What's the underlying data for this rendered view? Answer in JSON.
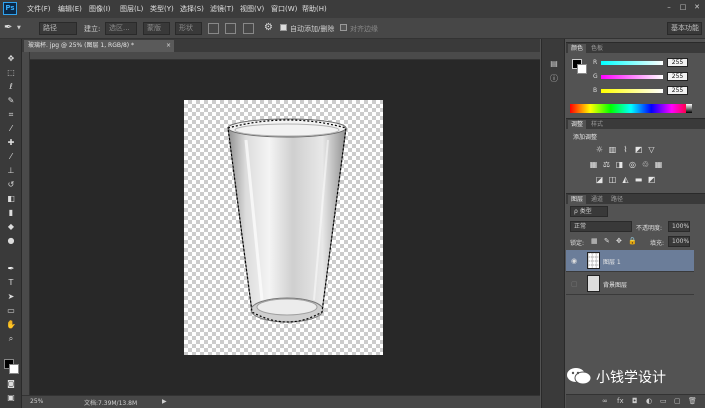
{
  "app": {
    "logo": "Ps"
  },
  "menu": [
    "文件(F)",
    "编辑(E)",
    "图像(I)",
    "图层(L)",
    "类型(Y)",
    "选择(S)",
    "滤镜(T)",
    "视图(V)",
    "窗口(W)",
    "帮助(H)"
  ],
  "window_controls": [
    "–",
    "□",
    "✕"
  ],
  "options": {
    "tool_preset": "路径",
    "build_label": "建立:",
    "select_btn": "选区...",
    "mask_btn": "蒙版",
    "shape_btn": "形状",
    "auto_add_delete": "自动添加/删除",
    "align_edges": "对齐边缘",
    "workspace": "基本功能"
  },
  "document": {
    "tab_title": "玻璃杯. jpg @ 25% (图层 1, RGB/8) *",
    "close": "×"
  },
  "status": {
    "zoom": "25%",
    "doc_size": "文档:7.39M/13.8M"
  },
  "color_panel": {
    "tabs": [
      "颜色",
      "色板"
    ],
    "channels": [
      {
        "letter": "R",
        "value": "255"
      },
      {
        "letter": "G",
        "value": "255"
      },
      {
        "letter": "B",
        "value": "255"
      }
    ]
  },
  "adjust_panel": {
    "tabs": [
      "调整",
      "样式"
    ],
    "title": "添加调整"
  },
  "layers_panel": {
    "tabs": [
      "图层",
      "通道",
      "路径"
    ],
    "filter": "ρ 类型",
    "blend_mode": "正常",
    "opacity_label": "不透明度:",
    "opacity": "100%",
    "lock_label": "锁定:",
    "fill_label": "填充:",
    "fill": "100%",
    "layers": [
      {
        "name": "图层 1",
        "selected": true
      },
      {
        "name": "背景图层",
        "selected": false
      }
    ],
    "bottom_icons": [
      "∞",
      "fx",
      "◘",
      "◐",
      "▭",
      "▢",
      "🗑"
    ]
  },
  "watermark": {
    "text": "小钱学设计"
  },
  "colors": {
    "accent_blue": "#2fa3f0",
    "panel": "#535353",
    "dark": "#3a3a3a",
    "canvas": "#282828"
  }
}
